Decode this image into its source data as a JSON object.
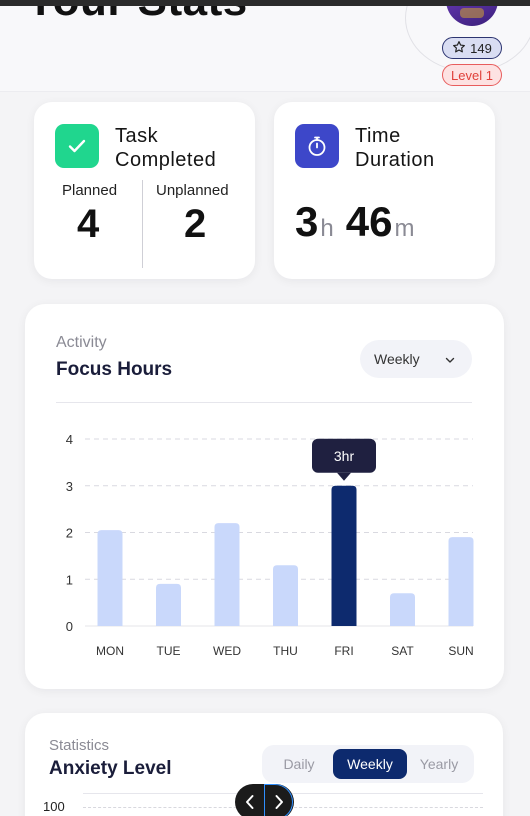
{
  "header": {
    "title": "Your Stats",
    "points": "149",
    "level": "Level 1"
  },
  "task_card": {
    "title_line1": "Task",
    "title_line2": "Completed",
    "planned_label": "Planned",
    "planned_value": "4",
    "unplanned_label": "Unplanned",
    "unplanned_value": "2"
  },
  "time_card": {
    "title_line1": "Time",
    "title_line2": "Duration",
    "hours": "3",
    "hours_unit": "h",
    "minutes": "46",
    "minutes_unit": "m"
  },
  "focus": {
    "subtitle": "Activity",
    "title": "Focus Hours",
    "period": "Weekly",
    "tooltip": "3hr"
  },
  "chart_data": {
    "type": "bar",
    "categories": [
      "MON",
      "TUE",
      "WED",
      "THU",
      "FRI",
      "SAT",
      "SUN"
    ],
    "values": [
      2.05,
      0.9,
      2.2,
      1.3,
      3.0,
      0.7,
      1.9
    ],
    "yticks": [
      "0",
      "1",
      "2",
      "3",
      "4"
    ],
    "ylim": [
      0,
      4
    ],
    "highlight_index": 4,
    "grid": true,
    "colors": {
      "bar": "#c9d8fb",
      "highlight": "#0d2a6e",
      "tooltip": "#1f2040"
    }
  },
  "anxiety": {
    "subtitle": "Statistics",
    "title": "Anxiety Level",
    "tabs": [
      "Daily",
      "Weekly",
      "Yearly"
    ],
    "active_tab": "Weekly",
    "first_tick": "100"
  }
}
